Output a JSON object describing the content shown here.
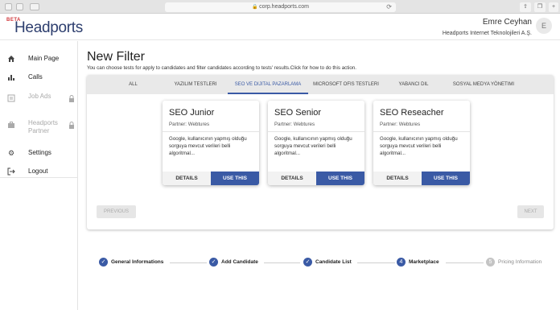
{
  "browser": {
    "url": "corp.headports.com",
    "reload_icon": "⟳"
  },
  "header": {
    "beta": "BETA",
    "logo": "Headports",
    "user_name": "Emre Ceyhan",
    "user_company": "Headports Internet Teknolojileri A.Ş.",
    "avatar_initial": "E"
  },
  "sidebar": {
    "items": [
      {
        "label": "Main Page",
        "icon": "home-icon"
      },
      {
        "label": "Calls",
        "icon": "bar-chart-icon"
      },
      {
        "label": "Job Ads",
        "icon": "list-icon",
        "locked": true
      },
      {
        "label": "Headports Partner",
        "icon": "briefcase-icon",
        "locked": true
      },
      {
        "label": "Settings",
        "icon": "gear-icon"
      },
      {
        "label": "Logout",
        "icon": "logout-icon"
      }
    ]
  },
  "main": {
    "title": "New Filter",
    "description": "You can choose tests for apply to candidates and filter candidates according to tests' results.Click for how to do this action.",
    "tabs": [
      {
        "label": "ALL"
      },
      {
        "label": "YAZILIM TESTLERI"
      },
      {
        "label": "SEO VE DIJITAL PAZARLAMA",
        "active": true
      },
      {
        "label": "MICROSOFT OFIS TESTLERI"
      },
      {
        "label": "YABANCI DIL"
      },
      {
        "label": "SOSYAL MEDYA YÖNETIMI"
      }
    ],
    "cards": [
      {
        "title": "SEO Junior",
        "partner": "Partner: Webtures",
        "desc": "Google, kullanıcının yapmış olduğu sorguya mevcut verileri belli algoritmal...",
        "details": "DETAILS",
        "use": "USE THIS"
      },
      {
        "title": "SEO Senior",
        "partner": "Partner: Webtures",
        "desc": "Google, kullanıcının yapmış olduğu sorguya mevcut verileri belli algoritmal...",
        "details": "DETAILS",
        "use": "USE THIS"
      },
      {
        "title": "SEO Reseacher",
        "partner": "Partner: Webtures",
        "desc": "Google, kullanıcının yapmış olduğu sorguya mevcut verileri belli algoritmal...",
        "details": "DETAILS",
        "use": "USE THIS"
      }
    ],
    "previous": "PREVIOUS",
    "next": "NEXT"
  },
  "stepper": {
    "steps": [
      {
        "label": "General Informations",
        "status": "done",
        "mark": "✓"
      },
      {
        "label": "Add Candidate",
        "status": "done",
        "mark": "✓"
      },
      {
        "label": "Candidate List",
        "status": "done",
        "mark": "✓"
      },
      {
        "label": "Marketplace",
        "status": "current",
        "mark": "4"
      },
      {
        "label": "Pricing Information",
        "status": "pending",
        "mark": "5"
      }
    ]
  },
  "colors": {
    "primary": "#3a5aa5",
    "brand": "#2d3e6e",
    "beta": "#d0363a"
  }
}
